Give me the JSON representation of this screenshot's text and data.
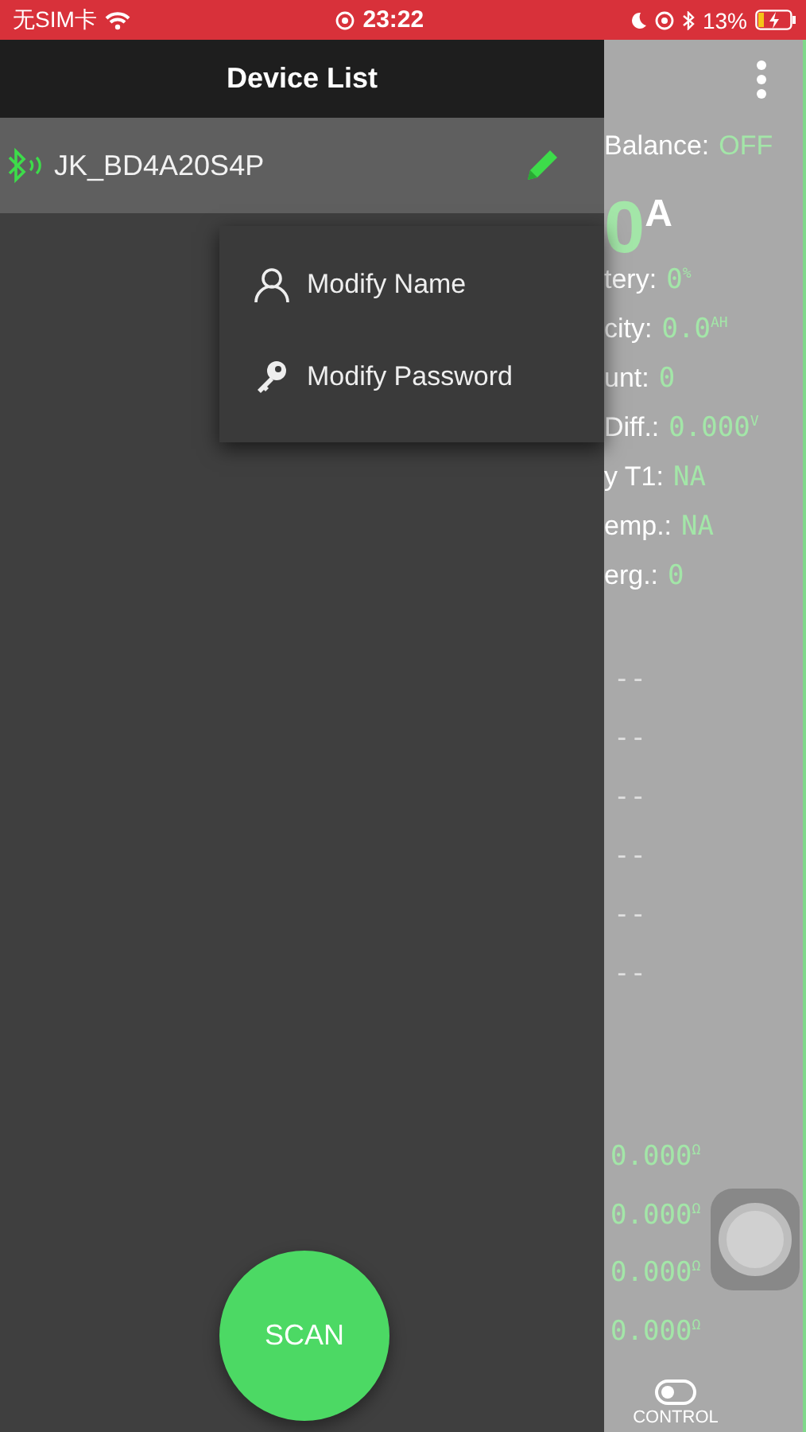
{
  "status_bar": {
    "carrier": "无SIM卡",
    "time": "23:22",
    "battery": "13%"
  },
  "drawer": {
    "title": "Device List",
    "devices": [
      {
        "name": "JK_BD4A20S4P",
        "selected": true
      }
    ],
    "menu": [
      {
        "label": "Modify Name",
        "kind": "user"
      },
      {
        "label": "Modify Password",
        "kind": "key"
      }
    ],
    "scan_button": "SCAN"
  },
  "main": {
    "balance": {
      "label": "Balance:",
      "value": "OFF"
    },
    "current": {
      "value": "0",
      "unit": "A"
    },
    "stats": [
      {
        "label": "tery:",
        "value": "0",
        "unit": "%"
      },
      {
        "label": "city:",
        "value": "0.0",
        "unit": "AH"
      },
      {
        "label": "unt:",
        "value": "0"
      },
      {
        "label": "Diff.:",
        "value": "0.000",
        "unit": "V"
      },
      {
        "label": "y T1:",
        "value": "NA"
      },
      {
        "label": "emp.:",
        "value": "NA"
      },
      {
        "label": "erg.:",
        "value": "0"
      }
    ],
    "cells": [
      "--",
      "--",
      "--",
      "--",
      "--",
      "--"
    ],
    "resistances": [
      {
        "value": "0.000",
        "unit": "Ω"
      },
      {
        "value": "0.000",
        "unit": "Ω"
      },
      {
        "value": "0.000",
        "unit": "Ω"
      },
      {
        "value": "0.000",
        "unit": "Ω"
      }
    ],
    "control": {
      "label": "CONTROL",
      "on": false
    }
  }
}
